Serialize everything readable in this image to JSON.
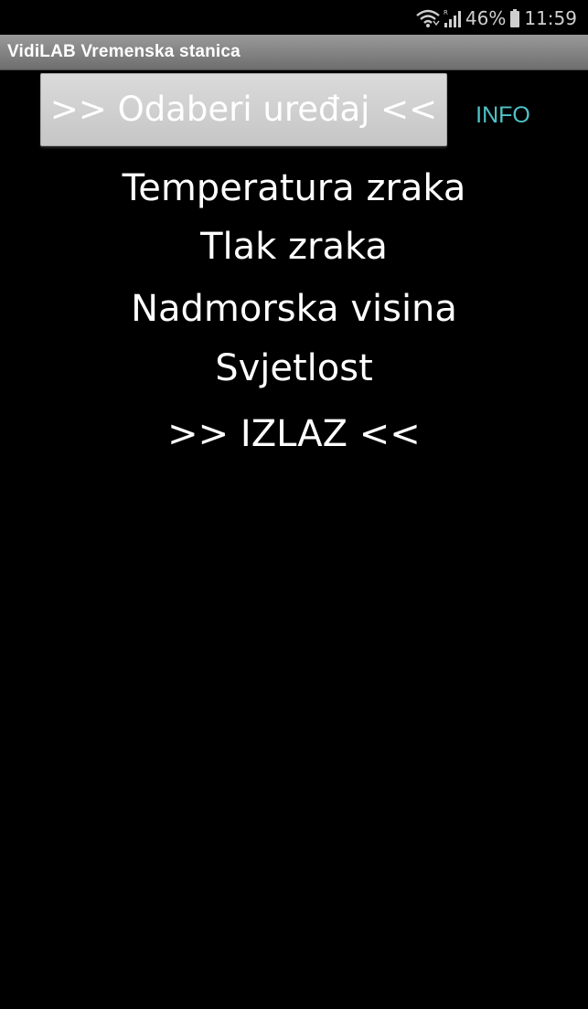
{
  "status_bar": {
    "battery_percent": "46%",
    "time": "11:59",
    "icons": [
      "wifi-icon",
      "signal-icon",
      "battery-icon"
    ]
  },
  "app": {
    "title": "VidiLAB Vremenska stanica"
  },
  "main": {
    "select_device_label": ">> Odaberi uređaj <<",
    "info_label": "INFO",
    "menu": [
      {
        "label": "Temperatura zraka"
      },
      {
        "label": "Tlak zraka"
      },
      {
        "label": "Nadmorska visina"
      },
      {
        "label": "Svjetlost"
      },
      {
        "label": ">> IZLAZ <<"
      }
    ]
  },
  "colors": {
    "background": "#000000",
    "info_accent": "#4fc3c8",
    "title_bar": "#808080",
    "button": "#d0d0d0"
  }
}
